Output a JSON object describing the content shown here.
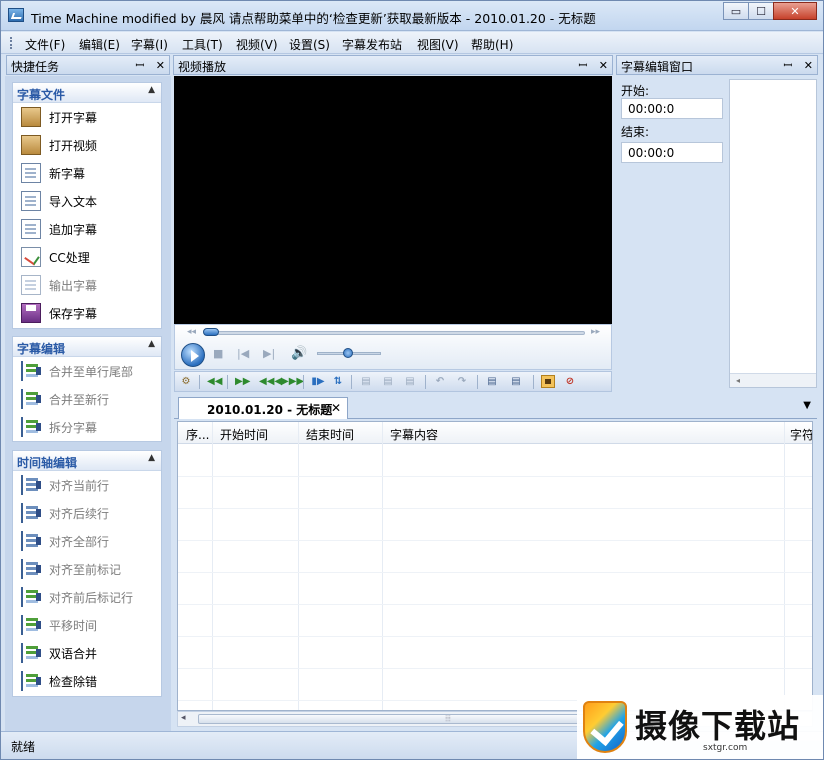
{
  "window": {
    "title": "Time Machine modified by 晨风 请点帮助菜单中的‘检查更新’获取最新版本 - 2010.01.20 - 无标题",
    "minimize": "▭",
    "maximize": "☐",
    "close": "✕"
  },
  "menu": [
    "文件(F)",
    "编辑(E)",
    "字幕(I)",
    "工具(T)",
    "视频(V)",
    "设置(S)",
    "字幕发布站",
    "视图(V)",
    "帮助(H)"
  ],
  "panels": {
    "quick_tasks": "快捷任务",
    "video": "视频播放",
    "editor": "字幕编辑窗口",
    "pin": "ꟷ",
    "close": "✕"
  },
  "groups": [
    {
      "title": "字幕文件",
      "items": [
        {
          "label": "打开字幕",
          "icon": "open-subtitle-icon",
          "enabled": true
        },
        {
          "label": "打开视频",
          "icon": "open-video-icon",
          "enabled": true
        },
        {
          "label": "新字幕",
          "icon": "new-subtitle-icon",
          "enabled": true
        },
        {
          "label": "导入文本",
          "icon": "import-text-icon",
          "enabled": true
        },
        {
          "label": "追加字幕",
          "icon": "append-subtitle-icon",
          "enabled": true
        },
        {
          "label": "CC处理",
          "icon": "cc-process-icon",
          "enabled": true
        },
        {
          "label": "输出字幕",
          "icon": "export-subtitle-icon",
          "enabled": false
        },
        {
          "label": "保存字幕",
          "icon": "save-subtitle-icon",
          "enabled": true
        }
      ]
    },
    {
      "title": "字幕编辑",
      "items": [
        {
          "label": "合并至单行尾部",
          "icon": "merge-line-end-icon",
          "enabled": false
        },
        {
          "label": "合并至新行",
          "icon": "merge-new-line-icon",
          "enabled": false
        },
        {
          "label": "拆分字幕",
          "icon": "split-subtitle-icon",
          "enabled": false
        }
      ]
    },
    {
      "title": "时间轴编辑",
      "items": [
        {
          "label": "对齐当前行",
          "icon": "align-current-icon",
          "enabled": false
        },
        {
          "label": "对齐后续行",
          "icon": "align-following-icon",
          "enabled": false
        },
        {
          "label": "对齐全部行",
          "icon": "align-all-icon",
          "enabled": false
        },
        {
          "label": "对齐至前标记",
          "icon": "align-prev-mark-icon",
          "enabled": false
        },
        {
          "label": "对齐前后标记行",
          "icon": "align-marks-icon",
          "enabled": false
        },
        {
          "label": "平移时间",
          "icon": "shift-time-icon",
          "enabled": false
        },
        {
          "label": "双语合并",
          "icon": "bilingual-merge-icon",
          "enabled": true
        },
        {
          "label": "检查除错",
          "icon": "check-errors-icon",
          "enabled": true
        }
      ]
    }
  ],
  "editor": {
    "start_label": "开始:",
    "start_value": "00:00:0",
    "end_label": "结束:",
    "end_value": "00:00:0"
  },
  "document_tab": {
    "label": "2010.01.20 - 无标题",
    "close": "✕",
    "menu": "▼"
  },
  "grid": {
    "columns": [
      "序...",
      "开始时间",
      "结束时间",
      "字幕内容",
      "字符"
    ]
  },
  "status": "就绪",
  "watermark": {
    "text": "摄像下载站",
    "url": "sxtgr.com"
  },
  "colors": {
    "accent": "#2a5aa6",
    "video_bg": "#000000"
  }
}
